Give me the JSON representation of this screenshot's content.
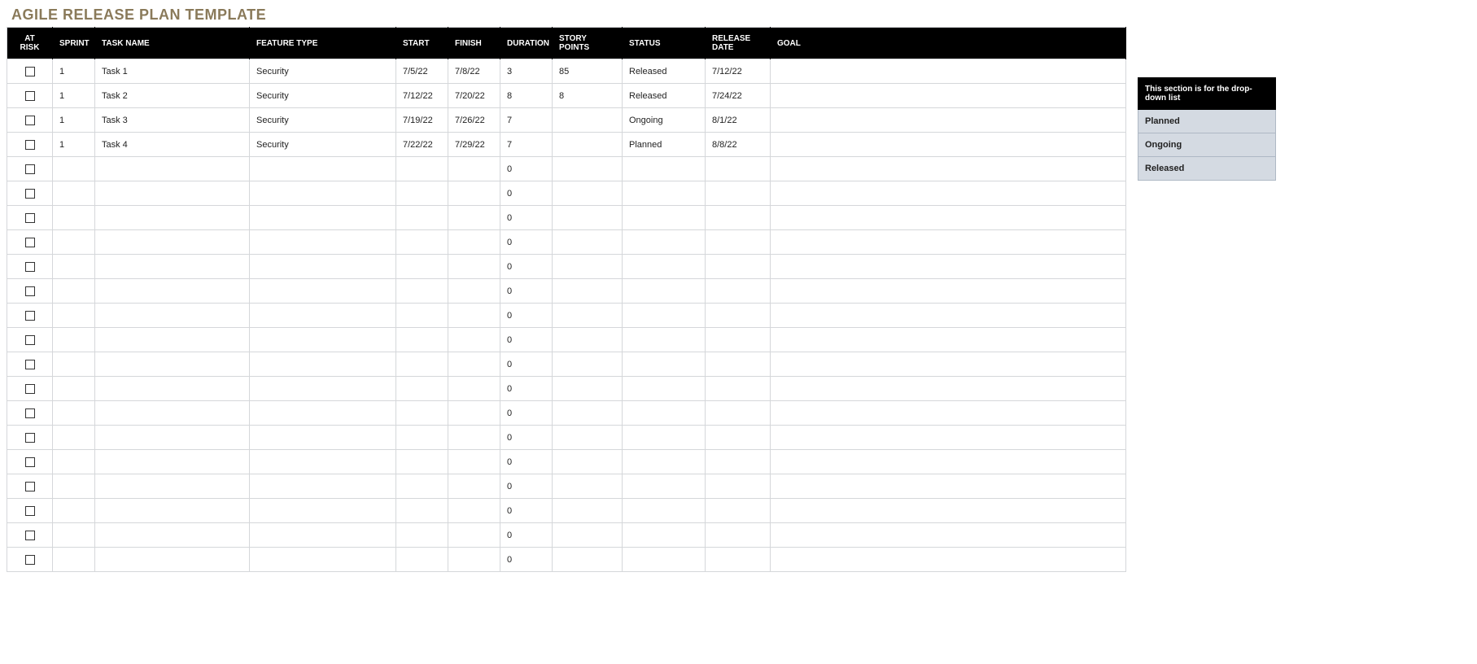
{
  "title": "AGILE RELEASE PLAN TEMPLATE",
  "columns": {
    "at_risk": "AT RISK",
    "sprint": "SPRINT",
    "task_name": "TASK NAME",
    "feature_type": "FEATURE TYPE",
    "start": "START",
    "finish": "FINISH",
    "duration": "DURATION",
    "story_points": "STORY POINTS",
    "status": "STATUS",
    "release_date": "RELEASE DATE",
    "goal": "GOAL"
  },
  "rows": [
    {
      "sprint": "1",
      "task_name": "Task 1",
      "feature_type": "Security",
      "start": "7/5/22",
      "finish": "7/8/22",
      "duration": "3",
      "story_points": "85",
      "status": "Released",
      "release_date": "7/12/22",
      "goal": ""
    },
    {
      "sprint": "1",
      "task_name": "Task 2",
      "feature_type": "Security",
      "start": "7/12/22",
      "finish": "7/20/22",
      "duration": "8",
      "story_points": "8",
      "status": "Released",
      "release_date": "7/24/22",
      "goal": ""
    },
    {
      "sprint": "1",
      "task_name": "Task 3",
      "feature_type": "Security",
      "start": "7/19/22",
      "finish": "7/26/22",
      "duration": "7",
      "story_points": "",
      "status": "Ongoing",
      "release_date": "8/1/22",
      "goal": ""
    },
    {
      "sprint": "1",
      "task_name": "Task 4",
      "feature_type": "Security",
      "start": "7/22/22",
      "finish": "7/29/22",
      "duration": "7",
      "story_points": "",
      "status": "Planned",
      "release_date": "8/8/22",
      "goal": ""
    },
    {
      "sprint": "",
      "task_name": "",
      "feature_type": "",
      "start": "",
      "finish": "",
      "duration": "0",
      "story_points": "",
      "status": "",
      "release_date": "",
      "goal": ""
    },
    {
      "sprint": "",
      "task_name": "",
      "feature_type": "",
      "start": "",
      "finish": "",
      "duration": "0",
      "story_points": "",
      "status": "",
      "release_date": "",
      "goal": ""
    },
    {
      "sprint": "",
      "task_name": "",
      "feature_type": "",
      "start": "",
      "finish": "",
      "duration": "0",
      "story_points": "",
      "status": "",
      "release_date": "",
      "goal": ""
    },
    {
      "sprint": "",
      "task_name": "",
      "feature_type": "",
      "start": "",
      "finish": "",
      "duration": "0",
      "story_points": "",
      "status": "",
      "release_date": "",
      "goal": ""
    },
    {
      "sprint": "",
      "task_name": "",
      "feature_type": "",
      "start": "",
      "finish": "",
      "duration": "0",
      "story_points": "",
      "status": "",
      "release_date": "",
      "goal": ""
    },
    {
      "sprint": "",
      "task_name": "",
      "feature_type": "",
      "start": "",
      "finish": "",
      "duration": "0",
      "story_points": "",
      "status": "",
      "release_date": "",
      "goal": ""
    },
    {
      "sprint": "",
      "task_name": "",
      "feature_type": "",
      "start": "",
      "finish": "",
      "duration": "0",
      "story_points": "",
      "status": "",
      "release_date": "",
      "goal": ""
    },
    {
      "sprint": "",
      "task_name": "",
      "feature_type": "",
      "start": "",
      "finish": "",
      "duration": "0",
      "story_points": "",
      "status": "",
      "release_date": "",
      "goal": ""
    },
    {
      "sprint": "",
      "task_name": "",
      "feature_type": "",
      "start": "",
      "finish": "",
      "duration": "0",
      "story_points": "",
      "status": "",
      "release_date": "",
      "goal": ""
    },
    {
      "sprint": "",
      "task_name": "",
      "feature_type": "",
      "start": "",
      "finish": "",
      "duration": "0",
      "story_points": "",
      "status": "",
      "release_date": "",
      "goal": ""
    },
    {
      "sprint": "",
      "task_name": "",
      "feature_type": "",
      "start": "",
      "finish": "",
      "duration": "0",
      "story_points": "",
      "status": "",
      "release_date": "",
      "goal": ""
    },
    {
      "sprint": "",
      "task_name": "",
      "feature_type": "",
      "start": "",
      "finish": "",
      "duration": "0",
      "story_points": "",
      "status": "",
      "release_date": "",
      "goal": ""
    },
    {
      "sprint": "",
      "task_name": "",
      "feature_type": "",
      "start": "",
      "finish": "",
      "duration": "0",
      "story_points": "",
      "status": "",
      "release_date": "",
      "goal": ""
    },
    {
      "sprint": "",
      "task_name": "",
      "feature_type": "",
      "start": "",
      "finish": "",
      "duration": "0",
      "story_points": "",
      "status": "",
      "release_date": "",
      "goal": ""
    },
    {
      "sprint": "",
      "task_name": "",
      "feature_type": "",
      "start": "",
      "finish": "",
      "duration": "0",
      "story_points": "",
      "status": "",
      "release_date": "",
      "goal": ""
    },
    {
      "sprint": "",
      "task_name": "",
      "feature_type": "",
      "start": "",
      "finish": "",
      "duration": "0",
      "story_points": "",
      "status": "",
      "release_date": "",
      "goal": ""
    },
    {
      "sprint": "",
      "task_name": "",
      "feature_type": "",
      "start": "",
      "finish": "",
      "duration": "0",
      "story_points": "",
      "status": "",
      "release_date": "",
      "goal": ""
    }
  ],
  "legend": {
    "header": "This section is for the drop-down list",
    "items": [
      "Planned",
      "Ongoing",
      "Released"
    ]
  }
}
